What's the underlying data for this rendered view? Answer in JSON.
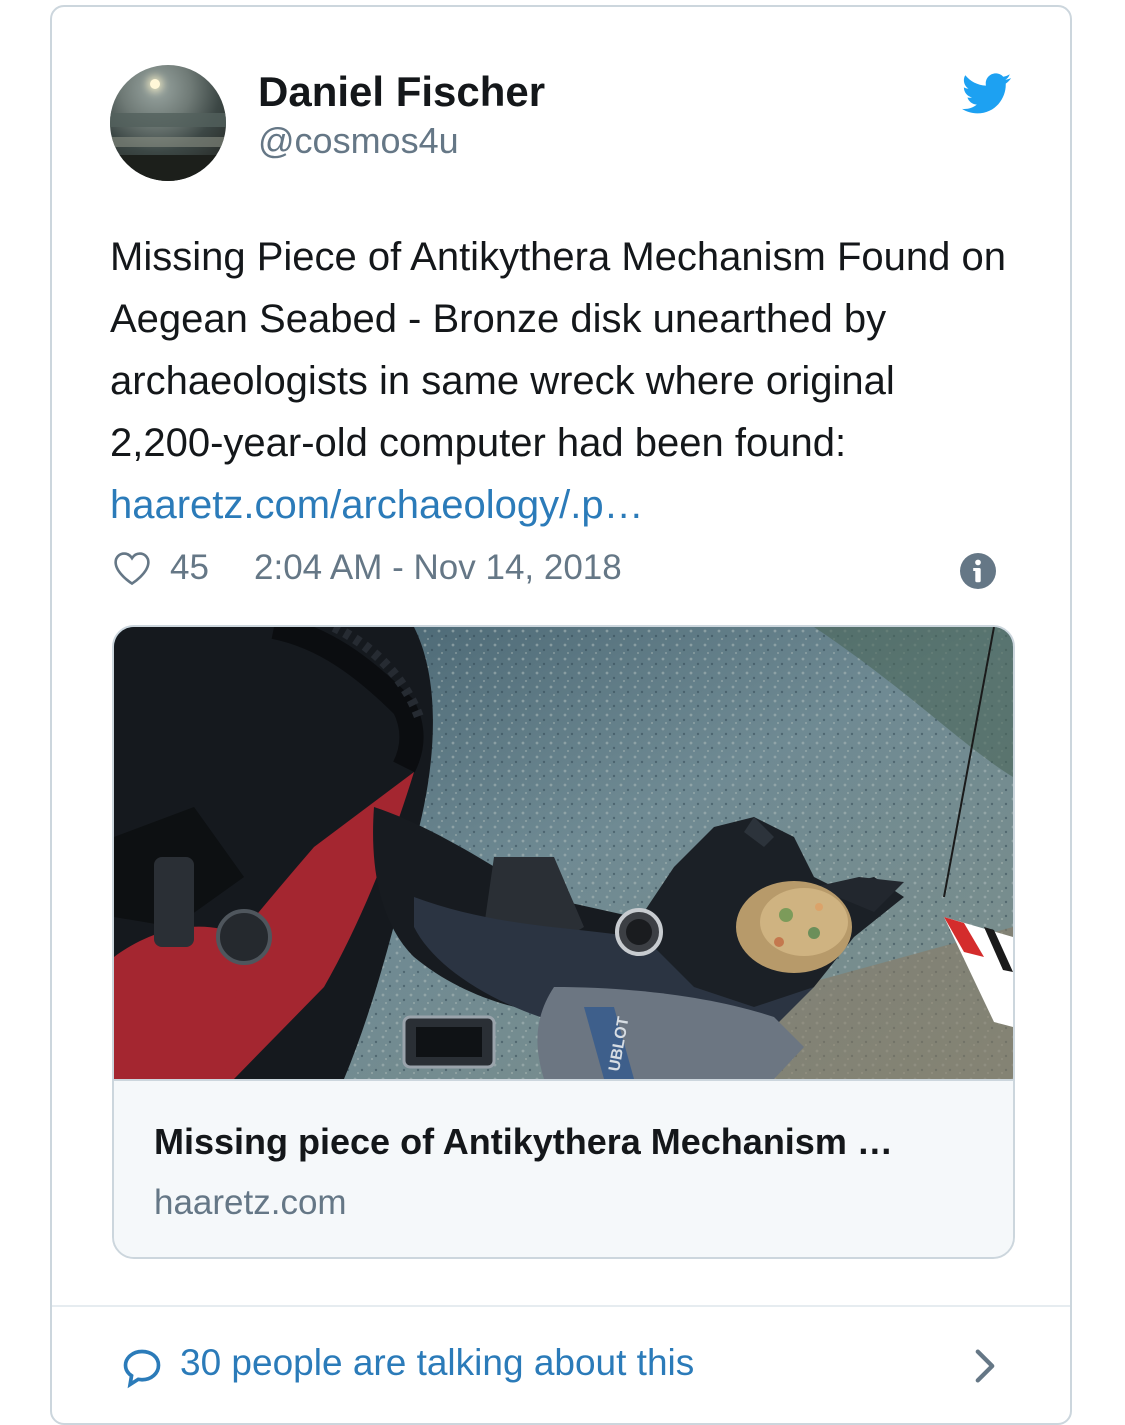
{
  "tweet": {
    "author_name": "Daniel Fischer",
    "author_handle": "@cosmos4u",
    "text": "Missing Piece of Antikythera Mechanism Found on Aegean Seabed - Bronze disk unearthed by archaeologists in same wreck where original 2,200-year-old computer had been found: ",
    "link_text": "haaretz.com/archaeology/.p…",
    "likes": "45",
    "timestamp": "2:04 AM - Nov 14, 2018"
  },
  "link_card": {
    "title": "Missing piece of Antikythera Mechanism …",
    "domain": "haaretz.com",
    "image_watch_brand": "UBLOT"
  },
  "conversation": {
    "label": "30 people are talking about this"
  },
  "colors": {
    "link_blue": "#2b7bb9",
    "twitter_blue": "#1da1f2",
    "muted_gray": "#657786",
    "text_dark": "#14171a",
    "border": "#ccd6dd"
  },
  "icons": {
    "brand": "twitter-bird-icon",
    "like": "heart-icon",
    "info": "info-icon",
    "reply": "speech-bubble-icon",
    "chevron": "chevron-right-icon"
  }
}
